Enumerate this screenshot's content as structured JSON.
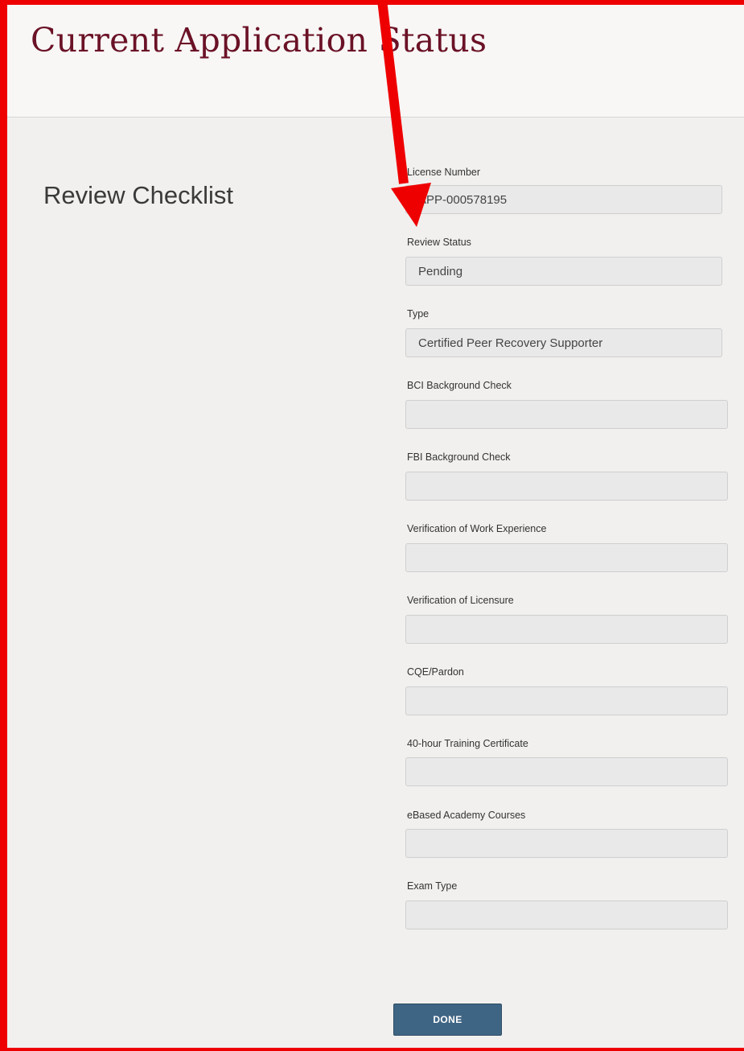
{
  "header": {
    "title": "Current Application Status"
  },
  "section": {
    "title": "Review Checklist"
  },
  "fields": {
    "license_number": {
      "label": "License Number",
      "value": "APP-000578195"
    },
    "review_status": {
      "label": "Review Status",
      "value": "Pending"
    },
    "type": {
      "label": "Type",
      "value": "Certified Peer Recovery Supporter"
    },
    "bci_background_check": {
      "label": "BCI Background Check",
      "value": ""
    },
    "fbi_background_check": {
      "label": "FBI Background Check",
      "value": ""
    },
    "work_experience": {
      "label": "Verification of Work Experience",
      "value": ""
    },
    "licensure": {
      "label": "Verification of Licensure",
      "value": ""
    },
    "cqe_pardon": {
      "label": "CQE/Pardon",
      "value": ""
    },
    "training_certificate": {
      "label": "40-hour Training Certificate",
      "value": ""
    },
    "ebased_academy": {
      "label": "eBased Academy Courses",
      "value": ""
    },
    "exam_type": {
      "label": "Exam Type",
      "value": ""
    }
  },
  "actions": {
    "done_label": "DONE"
  },
  "annotation": {
    "color": "#ee0000"
  }
}
